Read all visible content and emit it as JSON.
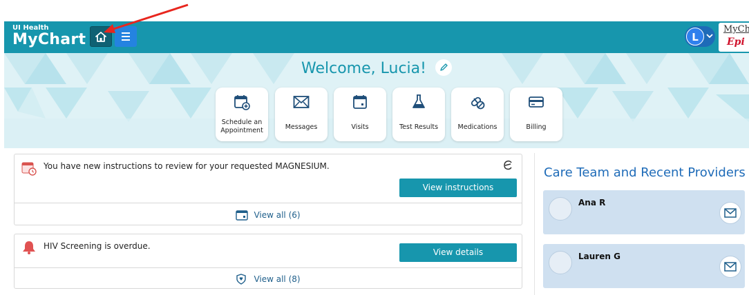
{
  "header": {
    "logo_small": "UI Health",
    "logo_big": "MyChart",
    "user_initial": "L",
    "epic_top": "MyCh",
    "epic_bottom": "Epi"
  },
  "hero": {
    "welcome": "Welcome, Lucia!"
  },
  "tiles": [
    {
      "label": "Schedule an Appointment",
      "icon": "calendar-add-icon"
    },
    {
      "label": "Messages",
      "icon": "envelope-icon"
    },
    {
      "label": "Visits",
      "icon": "calendar-icon"
    },
    {
      "label": "Test Results",
      "icon": "flask-icon"
    },
    {
      "label": "Medications",
      "icon": "pills-icon"
    },
    {
      "label": "Billing",
      "icon": "credit-card-icon"
    }
  ],
  "cards": [
    {
      "message": "You have new instructions to review for your requested MAGNESIUM.",
      "button": "View instructions",
      "view_all": "View all (6)"
    },
    {
      "message": "HIV Screening is overdue.",
      "button": "View details",
      "view_all": "View all (8)"
    }
  ],
  "care_team": {
    "title": "Care Team and Recent Providers",
    "providers": [
      {
        "name": "Ana R"
      },
      {
        "name": "Lauren G"
      }
    ]
  },
  "colors": {
    "header": "#1796ad",
    "accent": "#1796ad",
    "provider_card": "#cfe0f0"
  }
}
